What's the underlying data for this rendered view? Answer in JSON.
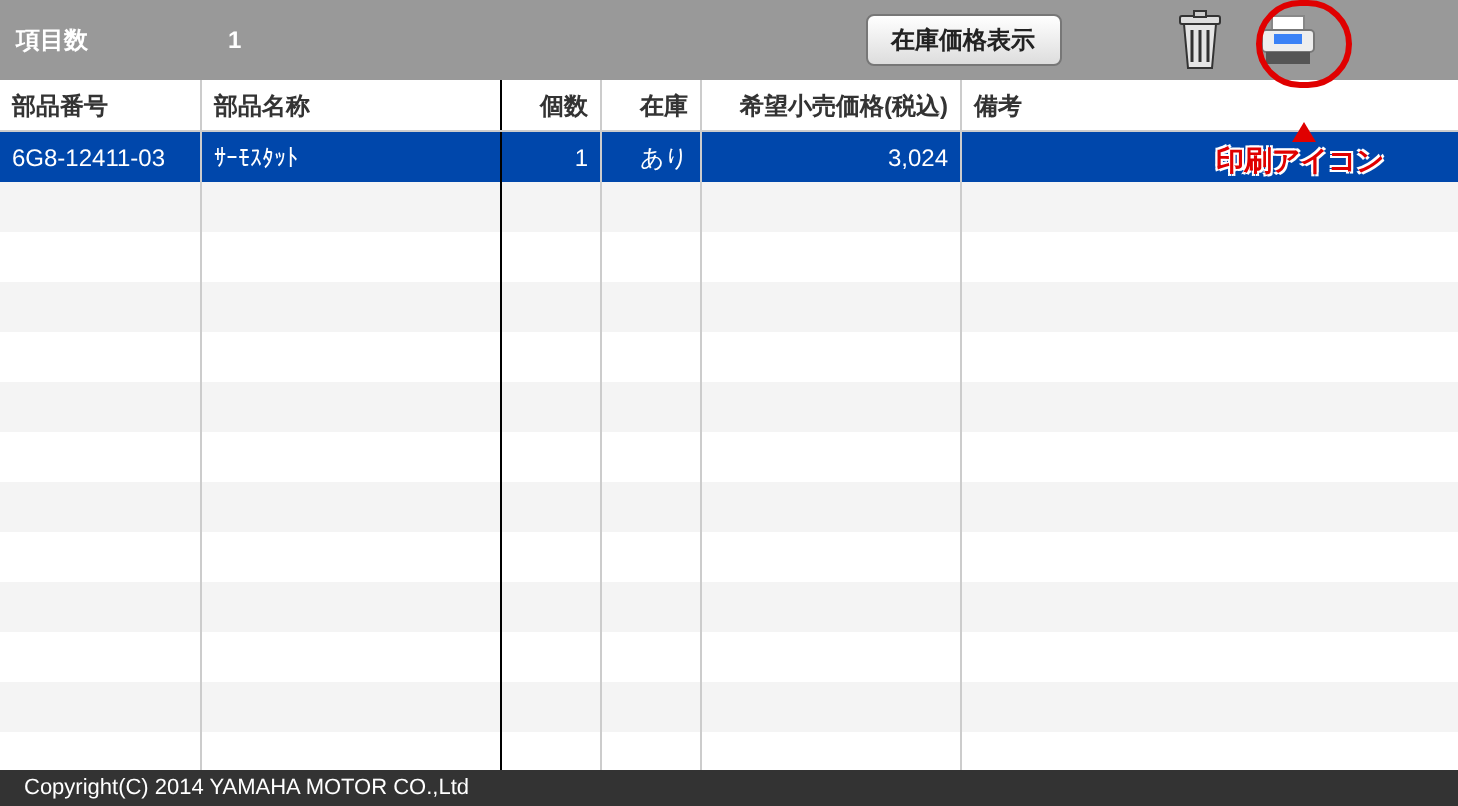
{
  "toolbar": {
    "count_label": "項目数",
    "count": "1",
    "stock_price_button": "在庫価格表示"
  },
  "annotation": {
    "label": "印刷アイコン"
  },
  "table": {
    "columns": [
      {
        "label": "部品番号"
      },
      {
        "label": "部品名称"
      },
      {
        "label": "個数"
      },
      {
        "label": "在庫"
      },
      {
        "label": "希望小売価格(税込)"
      },
      {
        "label": "備考"
      }
    ],
    "rows": [
      {
        "selected": true,
        "cells": [
          "6G8-12411-03",
          "ｻｰﾓｽﾀｯﾄ",
          "1",
          "あり",
          "3,024",
          ""
        ]
      }
    ]
  },
  "footer": {
    "copyright": "Copyright(C) 2014 YAMAHA MOTOR CO.,Ltd"
  }
}
